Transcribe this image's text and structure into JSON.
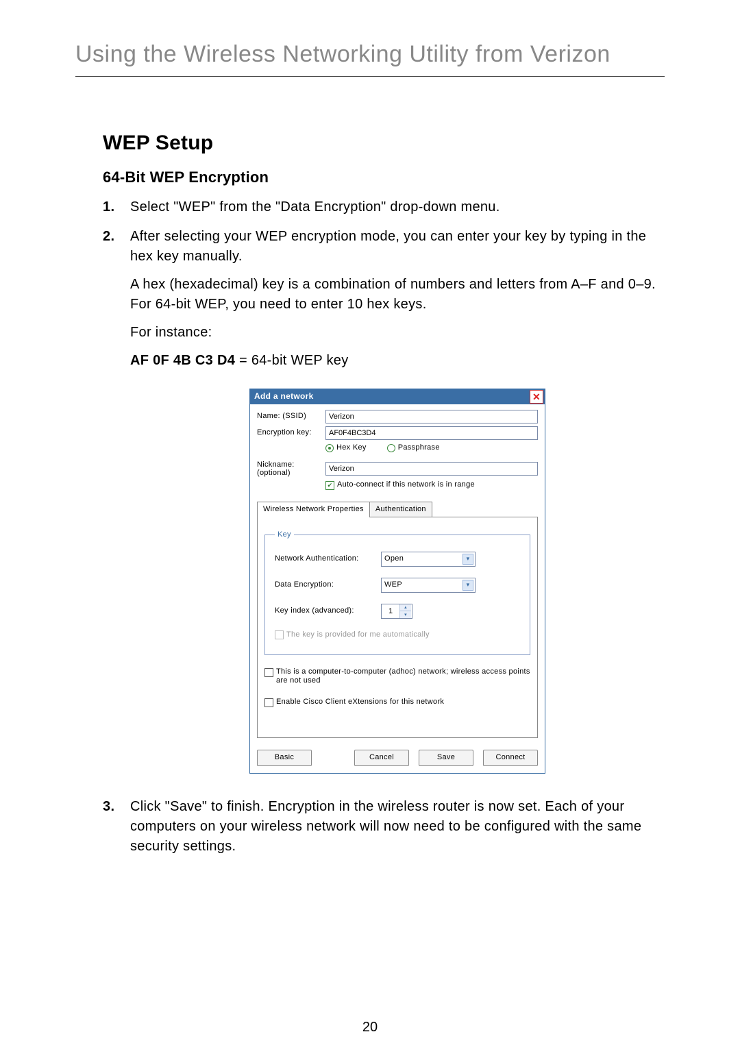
{
  "page": {
    "chapter_title": "Using the Wireless Networking Utility from Verizon",
    "section_h1": "WEP Setup",
    "section_h2": "64-Bit WEP Encryption",
    "page_number": "20"
  },
  "steps": {
    "s1": "Select \"WEP\" from the \"Data Encryption\" drop-down menu.",
    "s2": "After selecting your WEP encryption mode, you can enter your key by typing in the hex key manually.",
    "s2_p1": "A hex (hexadecimal) key is a combination of numbers and letters from A–F and 0–9. For 64-bit WEP, you need to enter 10 hex keys.",
    "s2_p2": "For instance:",
    "s2_p3_bold": "AF 0F 4B C3 D4",
    "s2_p3_rest": " = 64-bit WEP key",
    "s3": "Click \"Save\" to finish. Encryption in the wireless router is now set. Each of your computers on your wireless network will now need to be configured with the same security settings."
  },
  "dialog": {
    "title": "Add a network",
    "labels": {
      "ssid": "Name:  (SSID)",
      "enc_key": "Encryption key:",
      "nickname1": "Nickname:",
      "nickname2": "(optional)"
    },
    "values": {
      "ssid": "Verizon",
      "enc_key": "AF0F4BC3D4",
      "nickname": "Verizon"
    },
    "radio": {
      "hex": "Hex Key",
      "pass": "Passphrase"
    },
    "autoconnect": "Auto-connect if this network is in range",
    "tabs": {
      "props": "Wireless Network Properties",
      "auth": "Authentication"
    },
    "key_fs": {
      "legend": "Key",
      "net_auth_label": "Network Authentication:",
      "net_auth_value": "Open",
      "data_enc_label": "Data Encryption:",
      "data_enc_value": "WEP",
      "key_index_label": "Key index (advanced):",
      "key_index_value": "1",
      "auto_key": "The key is provided for me automatically"
    },
    "adhoc": "This is a computer-to-computer (adhoc) network; wireless access points are not used",
    "cisco": "Enable Cisco Client eXtensions for this network",
    "buttons": {
      "basic": "Basic",
      "cancel": "Cancel",
      "save": "Save",
      "connect": "Connect"
    }
  }
}
